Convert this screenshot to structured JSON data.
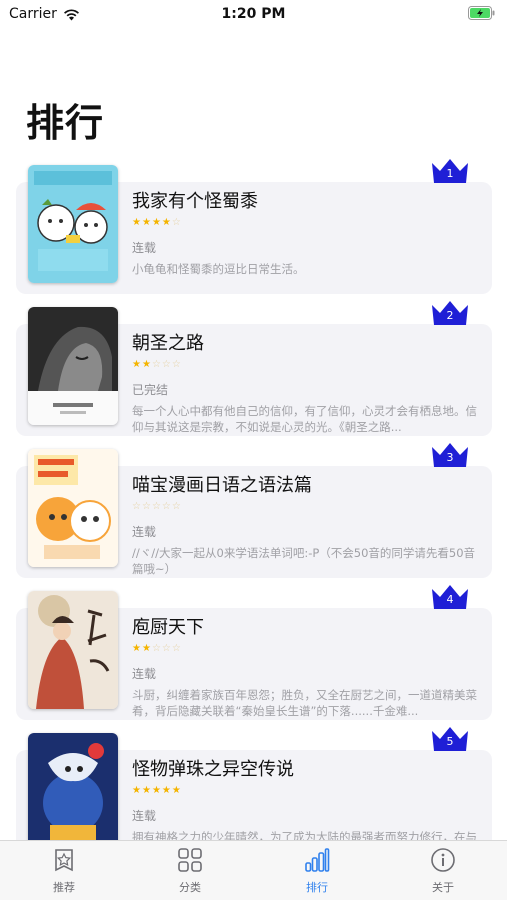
{
  "status_bar": {
    "carrier": "Carrier",
    "time": "1:20 PM"
  },
  "page": {
    "title": "排行"
  },
  "ranking": [
    {
      "rank": "1",
      "name": "我家有个怪蜀黍",
      "stars": 4,
      "status": "连载",
      "description": "小龟龟和怪蜀黍的逗比日常生活。"
    },
    {
      "rank": "2",
      "name": "朝圣之路",
      "stars": 2,
      "status": "已完结",
      "description": "每一个人心中都有他自己的信仰，有了信仰，心灵才会有栖息地。信仰与其说这是宗教，不如说是心灵的光。《朝圣之路..."
    },
    {
      "rank": "3",
      "name": "喵宝漫画日语之语法篇",
      "stars": 0,
      "status": "连载",
      "description": "//ヾ//大家一起从0来学语法单词吧:-P（不会50音的同学请先看50音篇哦~）"
    },
    {
      "rank": "4",
      "name": "庖厨天下",
      "stars": 2,
      "status": "连载",
      "description": "斗厨，纠缠着家族百年恩怨；胜负，又全在厨艺之间，一道道精美菜肴，背后隐藏关联着“秦始皇长生谱”的下落......千金难..."
    },
    {
      "rank": "5",
      "name": "怪物弹珠之异空传说",
      "stars": 5,
      "status": "连载",
      "description": "拥有神格之力的少年晴然，为了成为大陆的最强者而努力修行，在与传说中的怪物成为拍档的一刻，他的人生彻底改变..."
    }
  ],
  "tabs": [
    {
      "label": "推荐",
      "icon": "star-badge-icon",
      "active": false
    },
    {
      "label": "分类",
      "icon": "grid-icon",
      "active": false
    },
    {
      "label": "排行",
      "icon": "bar-chart-icon",
      "active": true
    },
    {
      "label": "关于",
      "icon": "info-icon",
      "active": false
    }
  ],
  "colors": {
    "crown": "#1f1fd6",
    "active_tab": "#2f80ed",
    "card_bg": "#f3f3f7",
    "star": "#f4b400"
  }
}
